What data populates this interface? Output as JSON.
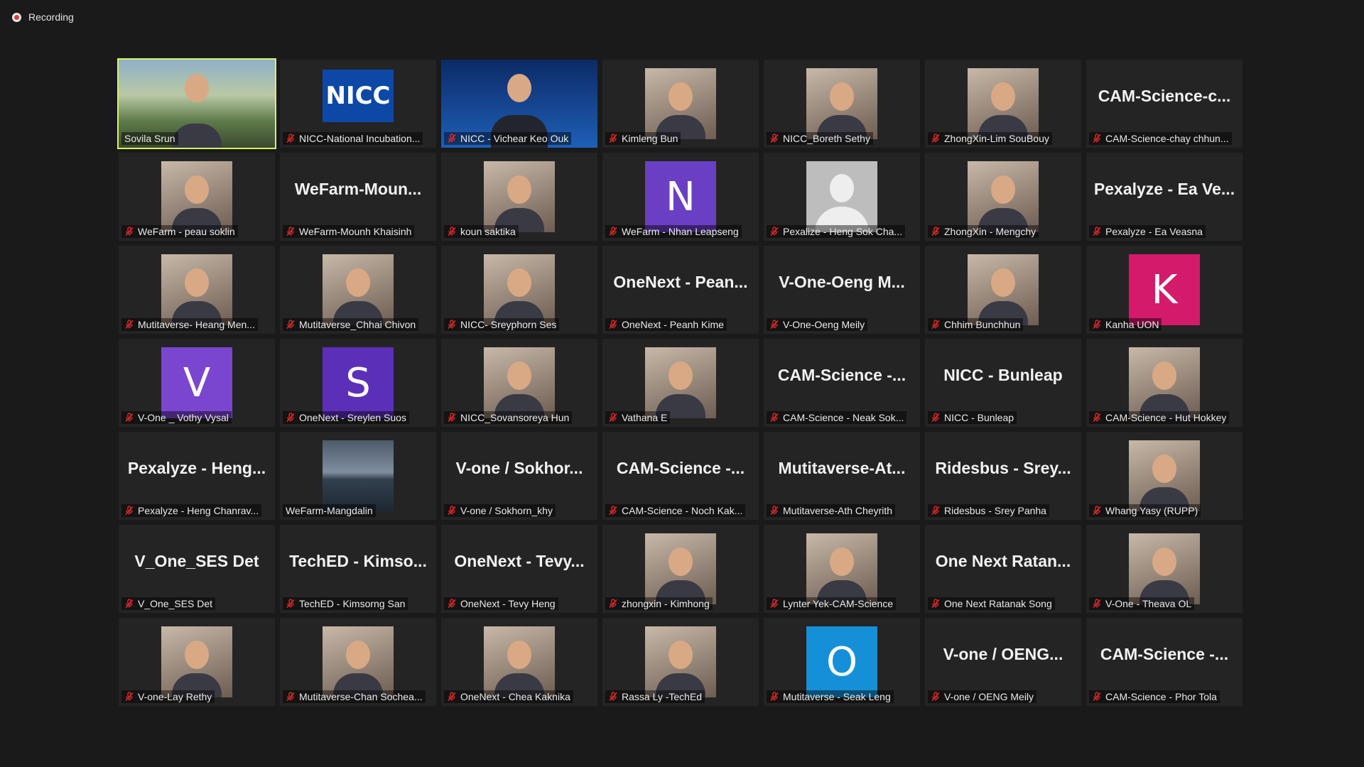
{
  "recording": {
    "label": "Recording"
  },
  "participants": [
    {
      "name": "Sovila Srun",
      "display": "photo",
      "muted": false,
      "active": true
    },
    {
      "name": "NICC-National Incubation...",
      "display": "logo",
      "logo_text": "NICC",
      "muted": true
    },
    {
      "name": "NICC - Vichear Keo Ouk",
      "display": "slide",
      "muted": true
    },
    {
      "name": "Kimleng Bun",
      "display": "photo",
      "muted": true
    },
    {
      "name": "NICC_Boreth Sethy",
      "display": "photo",
      "muted": true
    },
    {
      "name": "ZhongXin-Lim SouBouy",
      "display": "photo",
      "muted": true
    },
    {
      "name": "CAM-Science-chay chhun...",
      "display": "text",
      "big_text": "CAM-Science-c...",
      "muted": true
    },
    {
      "name": "WeFarm - peau soklin",
      "display": "photo",
      "muted": true
    },
    {
      "name": "WeFarm-Mounh Khaisinh",
      "display": "text",
      "big_text": "WeFarm-Moun...",
      "muted": true
    },
    {
      "name": "koun saktika",
      "display": "photo",
      "muted": true
    },
    {
      "name": "WeFarm - Nhan Leapseng",
      "display": "letter",
      "letter": "N",
      "color": "#6b3fc4",
      "muted": true
    },
    {
      "name": "Pexalize - Heng Sok Cha...",
      "display": "silhouette",
      "muted": true
    },
    {
      "name": "ZhongXin - Mengchy",
      "display": "photo",
      "muted": true
    },
    {
      "name": "Pexalyze - Ea Veasna",
      "display": "text",
      "big_text": "Pexalyze - Ea Ve...",
      "muted": true
    },
    {
      "name": "Mutitaverse- Heang Men...",
      "display": "photo",
      "muted": true
    },
    {
      "name": "Mutitaverse_Chhai Chivon",
      "display": "photo",
      "muted": true
    },
    {
      "name": "NICC- Sreyphorn Ses",
      "display": "photo",
      "muted": true
    },
    {
      "name": "OneNext - Peanh Kime",
      "display": "text",
      "big_text": "OneNext - Pean...",
      "muted": true
    },
    {
      "name": "V-One-Oeng Meily",
      "display": "text",
      "big_text": "V-One-Oeng M...",
      "muted": true
    },
    {
      "name": "Chhim Bunchhun",
      "display": "photo",
      "muted": true
    },
    {
      "name": "Kanha UON",
      "display": "letter",
      "letter": "K",
      "color": "#d41a6a",
      "muted": true
    },
    {
      "name": "V-One _ Vothy Vysal",
      "display": "letter",
      "letter": "V",
      "color": "#7a45cf",
      "muted": true
    },
    {
      "name": "OneNext - Sreylen Suos",
      "display": "letter",
      "letter": "S",
      "color": "#5b2fb8",
      "muted": true
    },
    {
      "name": "NICC_Sovansoreya Hun",
      "display": "photo",
      "muted": true
    },
    {
      "name": "Vathana E",
      "display": "photo",
      "muted": true
    },
    {
      "name": "CAM-Science - Neak Sok...",
      "display": "text",
      "big_text": "CAM-Science -...",
      "muted": true
    },
    {
      "name": "NICC - Bunleap",
      "display": "text",
      "big_text": "NICC - Bunleap",
      "muted": true
    },
    {
      "name": "CAM-Science - Hut Hokkey",
      "display": "photo",
      "muted": true
    },
    {
      "name": "Pexalyze - Heng Chanrav...",
      "display": "text",
      "big_text": "Pexalyze - Heng...",
      "muted": true
    },
    {
      "name": "WeFarm-Mangdalin",
      "display": "scenery",
      "muted": false
    },
    {
      "name": "V-one / Sokhorn_khy",
      "display": "text",
      "big_text": "V-one / Sokhor...",
      "muted": true
    },
    {
      "name": "CAM-Science - Noch Kak...",
      "display": "text",
      "big_text": "CAM-Science -...",
      "muted": true
    },
    {
      "name": "Mutitaverse-Ath Cheyrith",
      "display": "text",
      "big_text": "Mutitaverse-At...",
      "muted": true
    },
    {
      "name": "Ridesbus - Srey Panha",
      "display": "text",
      "big_text": "Ridesbus - Srey...",
      "muted": true
    },
    {
      "name": "Whang Yasy (RUPP)",
      "display": "photo",
      "muted": true
    },
    {
      "name": "V_One_SES Det",
      "display": "text",
      "big_text": "V_One_SES Det",
      "muted": true
    },
    {
      "name": "TechED - Kimsorng San",
      "display": "text",
      "big_text": "TechED - Kimso...",
      "muted": true
    },
    {
      "name": "OneNext - Tevy Heng",
      "display": "text",
      "big_text": "OneNext - Tevy...",
      "muted": true
    },
    {
      "name": "zhongxin - Kimhong",
      "display": "photo",
      "muted": true
    },
    {
      "name": "Lynter Yek-CAM-Science",
      "display": "photo",
      "muted": true
    },
    {
      "name": "One Next Ratanak Song",
      "display": "text",
      "big_text": "One Next Ratan...",
      "muted": true
    },
    {
      "name": "V-One - Theava OL",
      "display": "photo",
      "muted": true
    },
    {
      "name": "V-one-Lay Rethy",
      "display": "photo",
      "muted": true
    },
    {
      "name": "Mutitaverse-Chan Sochea...",
      "display": "photo",
      "muted": true
    },
    {
      "name": "OneNext - Chea Kaknika",
      "display": "photo",
      "muted": true
    },
    {
      "name": "Rassa Ly -TechEd",
      "display": "photo",
      "muted": true
    },
    {
      "name": "Mutitaverse - Seak Leng",
      "display": "letter",
      "letter": "O",
      "color": "#1590d8",
      "muted": true
    },
    {
      "name": "V-one / OENG Meily",
      "display": "text",
      "big_text": "V-one / OENG...",
      "muted": true
    },
    {
      "name": "CAM-Science - Phor Tola",
      "display": "text",
      "big_text": "CAM-Science -...",
      "muted": true
    }
  ]
}
